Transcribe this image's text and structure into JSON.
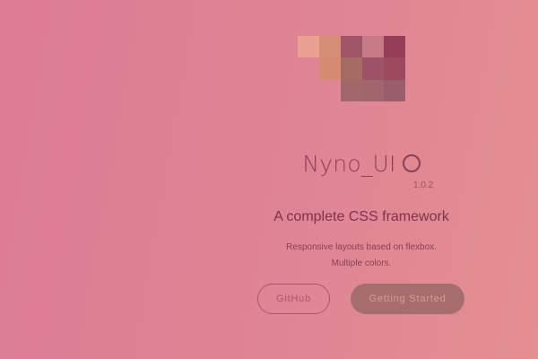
{
  "brand": {
    "name": "Nyno_UI",
    "version": "1.0.2"
  },
  "tagline": "A complete CSS framework",
  "description": {
    "line1": "Responsive layouts based on flexbox.",
    "line2": "Multiple colors."
  },
  "buttons": {
    "github_label": "GitHub",
    "start_label": "Getting Started"
  },
  "colors": {
    "background_left": "#dc7c94",
    "background_right": "#e48f92",
    "title": "#8e3e58",
    "primary_button": "#a56d6e"
  }
}
